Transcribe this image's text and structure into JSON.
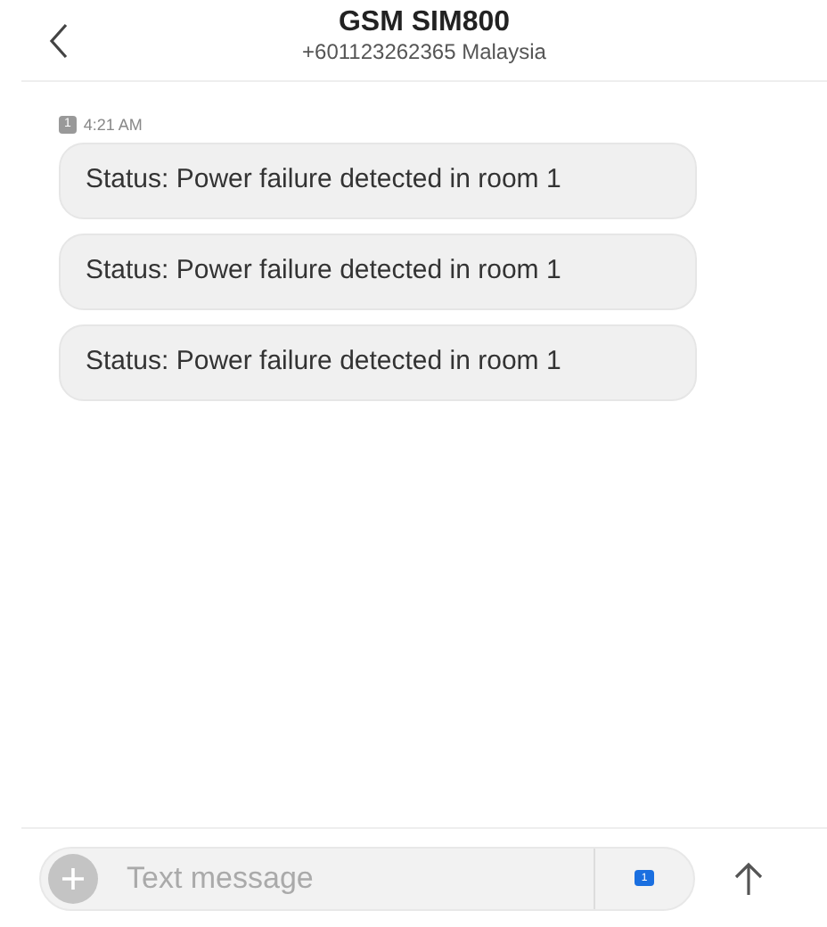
{
  "header": {
    "title": "GSM SIM800",
    "subtitle": "+601123262365 Malaysia"
  },
  "timestamp": {
    "sim": "1",
    "time": "4:21 AM"
  },
  "messages": [
    {
      "text": "Status: Power failure detected in room 1"
    },
    {
      "text": "Status: Power failure detected in room 1"
    },
    {
      "text": "Status: Power failure detected in room 1"
    }
  ],
  "composer": {
    "placeholder": "Text message",
    "sim": "1"
  }
}
